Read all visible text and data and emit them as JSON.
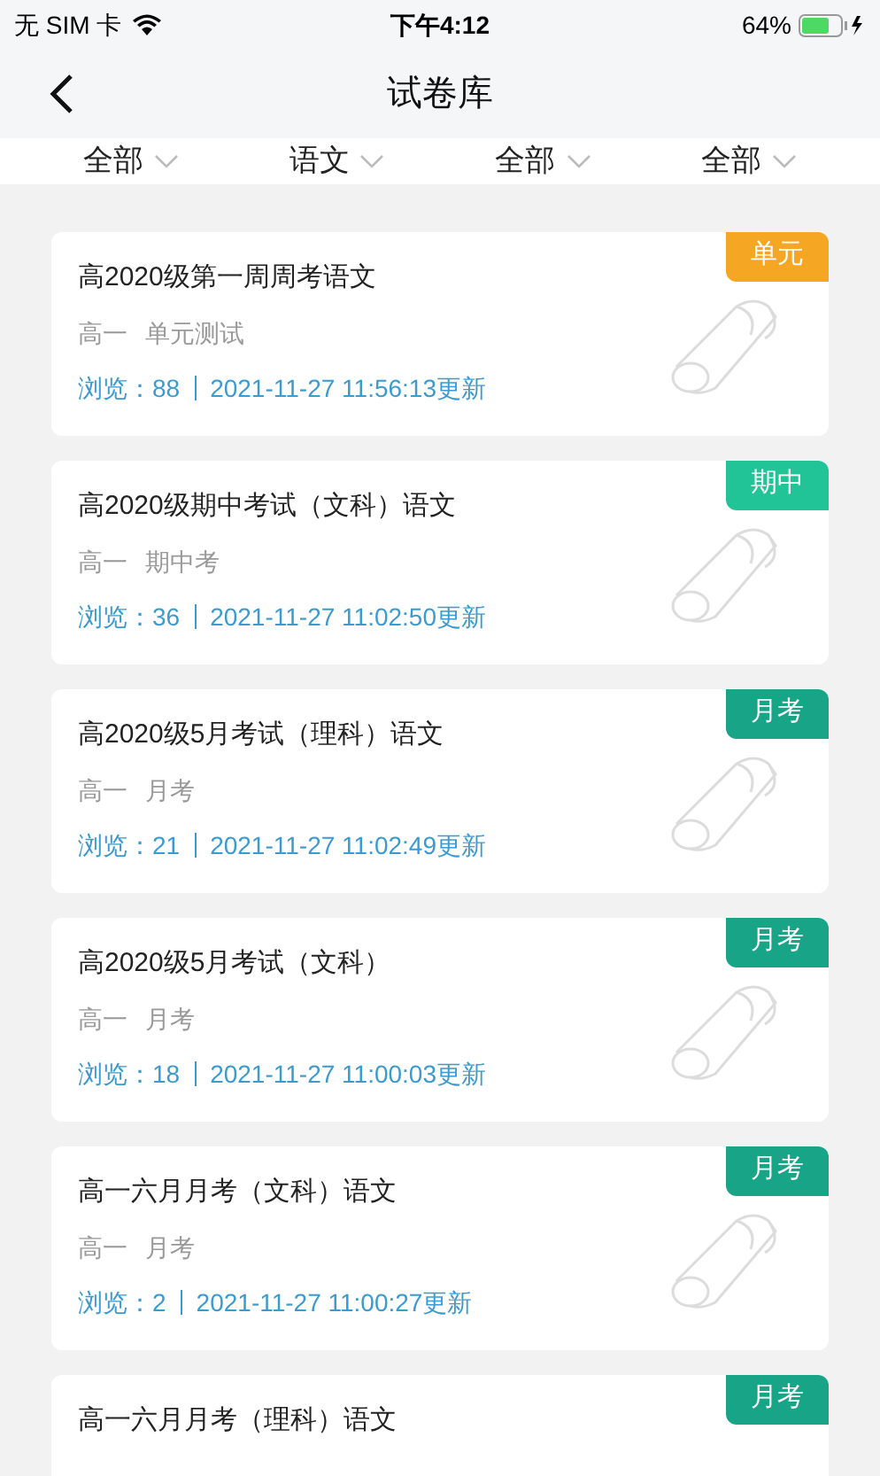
{
  "status_bar": {
    "carrier": "无 SIM 卡",
    "time": "下午4:12",
    "battery": "64%"
  },
  "nav": {
    "title": "试卷库"
  },
  "filters": [
    {
      "label": "全部"
    },
    {
      "label": "语文"
    },
    {
      "label": "全部"
    },
    {
      "label": "全部"
    }
  ],
  "papers": [
    {
      "title": "高2020级第一周周考语文",
      "grade": "高一",
      "type": "单元测试",
      "views": "浏览：88",
      "updated": "2021-11-27 11:56:13更新",
      "tag": "单元",
      "color": "#f5a623"
    },
    {
      "title": "高2020级期中考试（文科）语文",
      "grade": "高一",
      "type": "期中考",
      "views": "浏览：36",
      "updated": "2021-11-27 11:02:50更新",
      "tag": "期中",
      "color": "#21c497"
    },
    {
      "title": "高2020级5月考试（理科）语文",
      "grade": "高一",
      "type": "月考",
      "views": "浏览：21",
      "updated": "2021-11-27 11:02:49更新",
      "tag": "月考",
      "color": "#17a487"
    },
    {
      "title": "高2020级5月考试（文科）",
      "grade": "高一",
      "type": "月考",
      "views": "浏览：18",
      "updated": "2021-11-27 11:00:03更新",
      "tag": "月考",
      "color": "#17a487"
    },
    {
      "title": "高一六月月考（文科）语文",
      "grade": "高一",
      "type": "月考",
      "views": "浏览：2",
      "updated": "2021-11-27 11:00:27更新",
      "tag": "月考",
      "color": "#17a487"
    },
    {
      "title": "高一六月月考（理科）语文",
      "tag": "月考",
      "color": "#17a487"
    }
  ]
}
